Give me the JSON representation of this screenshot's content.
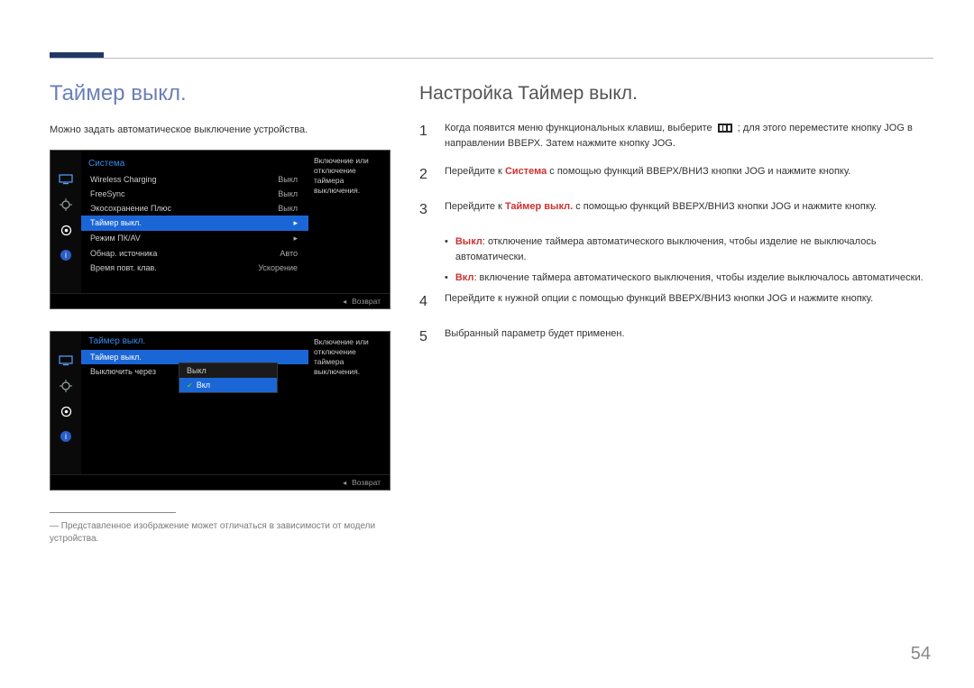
{
  "page_number": "54",
  "left": {
    "title": "Таймер выкл.",
    "intro": "Можно задать автоматическое выключение устройства.",
    "osd1": {
      "title": "Система",
      "rows": [
        {
          "label": "Wireless Charging",
          "value": "Выкл"
        },
        {
          "label": "FreeSync",
          "value": "Выкл"
        },
        {
          "label": "Экосохранение Плюс",
          "value": "Выкл"
        },
        {
          "label": "Таймер выкл.",
          "value": "▸",
          "hl": true
        },
        {
          "label": "Режим ПК/AV",
          "value": "▸"
        },
        {
          "label": "Обнар. источника",
          "value": "Авто"
        },
        {
          "label": "Время повт. клав.",
          "value": "Ускорение"
        }
      ],
      "detail": "Включение или отключение таймера выключения.",
      "foot": "Возврат"
    },
    "osd2": {
      "title": "Таймер выкл.",
      "rows": [
        {
          "label": "Таймер выкл.",
          "hl": true
        },
        {
          "label": "Выключить через"
        }
      ],
      "options": [
        {
          "label": "Выкл",
          "sel": false
        },
        {
          "label": "Вкл",
          "sel": true
        }
      ],
      "detail": "Включение или отключение таймера выключения.",
      "foot": "Возврат"
    },
    "footnote": "Представленное изображение может отличаться в зависимости от модели устройства."
  },
  "right": {
    "title": "Настройка Таймер выкл.",
    "steps": {
      "s1_a": "Когда появится меню функциональных клавиш, выберите ",
      "s1_b": " ; для этого переместите кнопку JOG в направлении ВВЕРХ. Затем нажмите кнопку JOG.",
      "s2_a": "Перейдите к ",
      "s2_kw": "Система",
      "s2_b": " с помощью функций ВВЕРХ/ВНИЗ кнопки JOG и нажмите кнопку.",
      "s3_a": "Перейдите к ",
      "s3_kw": "Таймер выкл.",
      "s3_b": " с помощью функций ВВЕРХ/ВНИЗ кнопки JOG и нажмите кнопку.",
      "b1_kw": "Выкл",
      "b1_txt": ": отключение таймера автоматического выключения, чтобы изделие не выключалось автоматически.",
      "b2_kw": "Вкл",
      "b2_txt": ": включение таймера автоматического выключения, чтобы изделие выключалось автоматически.",
      "s4": "Перейдите к нужной опции с помощью функций ВВЕРХ/ВНИЗ кнопки JOG и нажмите кнопку.",
      "s5": "Выбранный параметр будет применен."
    }
  }
}
